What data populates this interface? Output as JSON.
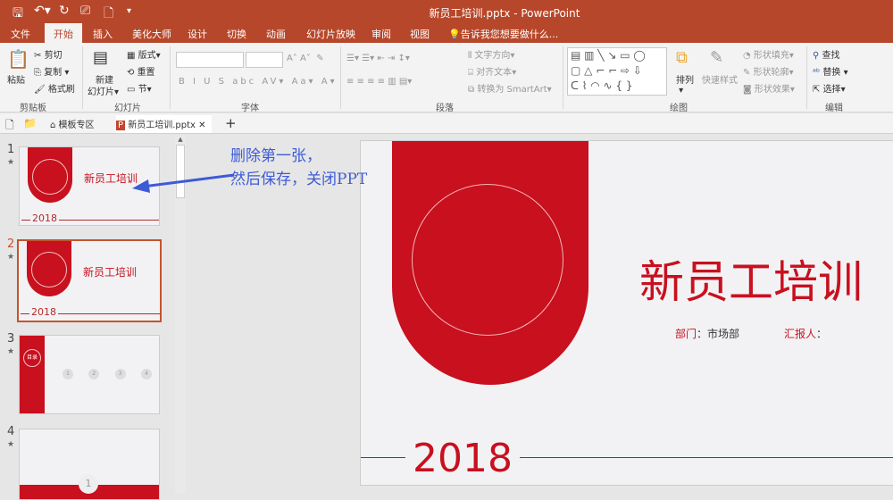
{
  "titlebar": {
    "title": "新员工培训.pptx - PowerPoint"
  },
  "tabs": [
    "文件",
    "开始",
    "插入",
    "美化大师",
    "设计",
    "切换",
    "动画",
    "幻灯片放映",
    "审阅",
    "视图"
  ],
  "tell_me": "告诉我您想要做什么...",
  "ribbon": {
    "clipboard": {
      "paste": "粘贴",
      "cut": "剪切",
      "copy": "复制",
      "format_painter": "格式刷",
      "label": "剪贴板"
    },
    "slides": {
      "new_slide": "新建",
      "new_slide2": "幻灯片",
      "layout": "版式",
      "reset": "重置",
      "section": "节",
      "label": "幻灯片"
    },
    "font": {
      "label": "字体"
    },
    "paragraph": {
      "text_direction": "文字方向",
      "align_text": "对齐文本",
      "smartart": "转换为 SmartArt",
      "label": "段落"
    },
    "drawing": {
      "arrange": "排列",
      "quick_styles": "快速样式",
      "fill": "形状填充",
      "outline": "形状轮廓",
      "effects": "形状效果",
      "label": "绘图"
    },
    "editing": {
      "find": "查找",
      "replace": "替换",
      "select": "选择",
      "label": "编辑"
    }
  },
  "filetabs": {
    "templates": "模板专区",
    "file": "新员工培训.pptx"
  },
  "thumbs": [
    {
      "n": "1"
    },
    {
      "n": "2"
    },
    {
      "n": "3"
    },
    {
      "n": "4"
    }
  ],
  "slide": {
    "title": "新员工培训",
    "dept_label": "部门",
    "dept_value": "：市场部",
    "reporter_label": "汇报人",
    "reporter_value": "：",
    "year": "2018"
  },
  "thumb_text": {
    "title": "新员工培训",
    "year": "2018",
    "toc": "目录",
    "steps": [
      "1",
      "2",
      "3",
      "4"
    ]
  },
  "annotation": {
    "line1": "删除第一张，",
    "line2": "然后保存，关闭PPT"
  },
  "colors": {
    "accent": "#b7472a",
    "red": "#c8101e",
    "note": "#3d5bd6"
  }
}
